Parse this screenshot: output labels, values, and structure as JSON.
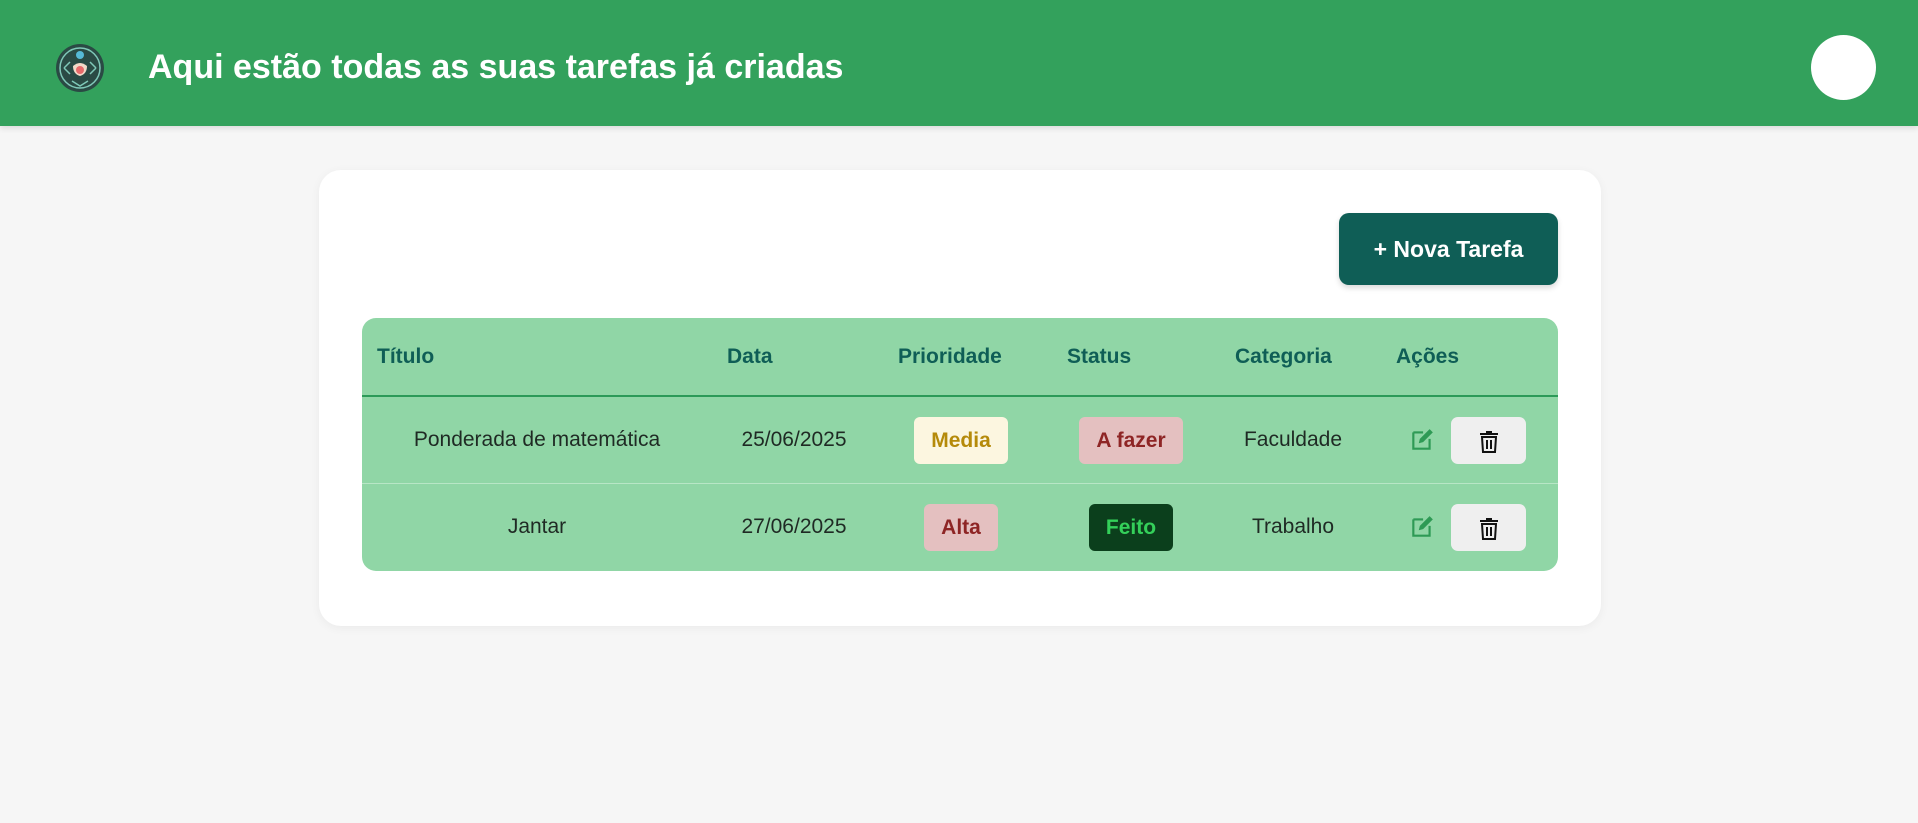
{
  "header": {
    "title": "Aqui estão todas as suas tarefas já criadas",
    "logo_icon": "compass-emblem-icon",
    "background_color": "#33a15c"
  },
  "toolbar": {
    "new_task_label": "+ Nova Tarefa",
    "new_task_color": "#0f5e56"
  },
  "table": {
    "columns": [
      "Título",
      "Data",
      "Prioridade",
      "Status",
      "Categoria",
      "Ações"
    ],
    "rows": [
      {
        "titulo": "Ponderada de matemática",
        "data": "25/06/2025",
        "prioridade": "Media",
        "status": "A fazer",
        "categoria": "Faculdade"
      },
      {
        "titulo": "Jantar",
        "data": "27/06/2025",
        "prioridade": "Alta",
        "status": "Feito",
        "categoria": "Trabalho"
      }
    ],
    "action_icons": [
      "edit-icon",
      "trash-icon"
    ],
    "badge_colors": {
      "media": {
        "bg": "#fcf6e0",
        "fg": "#b58a0a"
      },
      "alta": {
        "bg": "#e4c0c0",
        "fg": "#8e2525"
      },
      "a_fazer": {
        "bg": "#e4c0c0",
        "fg": "#8e2525"
      },
      "feito": {
        "bg": "#0b3f1c",
        "fg": "#34d05a"
      }
    }
  }
}
